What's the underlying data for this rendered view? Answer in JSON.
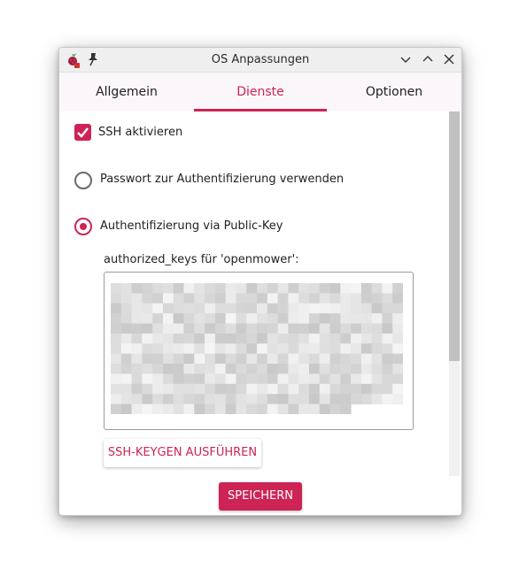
{
  "window": {
    "title": "OS Anpassungen",
    "icons": [
      "raspberry-pi-icon",
      "pin-icon",
      "minimize-icon",
      "maximize-icon",
      "close-icon"
    ]
  },
  "tabs": [
    {
      "label": "Allgemein",
      "active": false
    },
    {
      "label": "Dienste",
      "active": true
    },
    {
      "label": "Optionen",
      "active": false
    }
  ],
  "services": {
    "ssh_enable_label": "SSH aktivieren",
    "ssh_enabled": true,
    "password_auth_label": "Passwort zur Authentifizierung verwenden",
    "password_auth_selected": false,
    "pubkey_auth_label": "Authentifizierung via Public-Key",
    "pubkey_auth_selected": true,
    "authorized_keys_label": "authorized_keys für 'openmower':",
    "authorized_keys_value": "",
    "keygen_button_label": "SSH-KEYGEN AUSFÜHREN"
  },
  "footer": {
    "save_button_label": "SPEICHERN"
  },
  "colors": {
    "accent": "#cd2355",
    "tab_bar_bg": "#fbf6fa",
    "titlebar_bg": "#efefef"
  }
}
